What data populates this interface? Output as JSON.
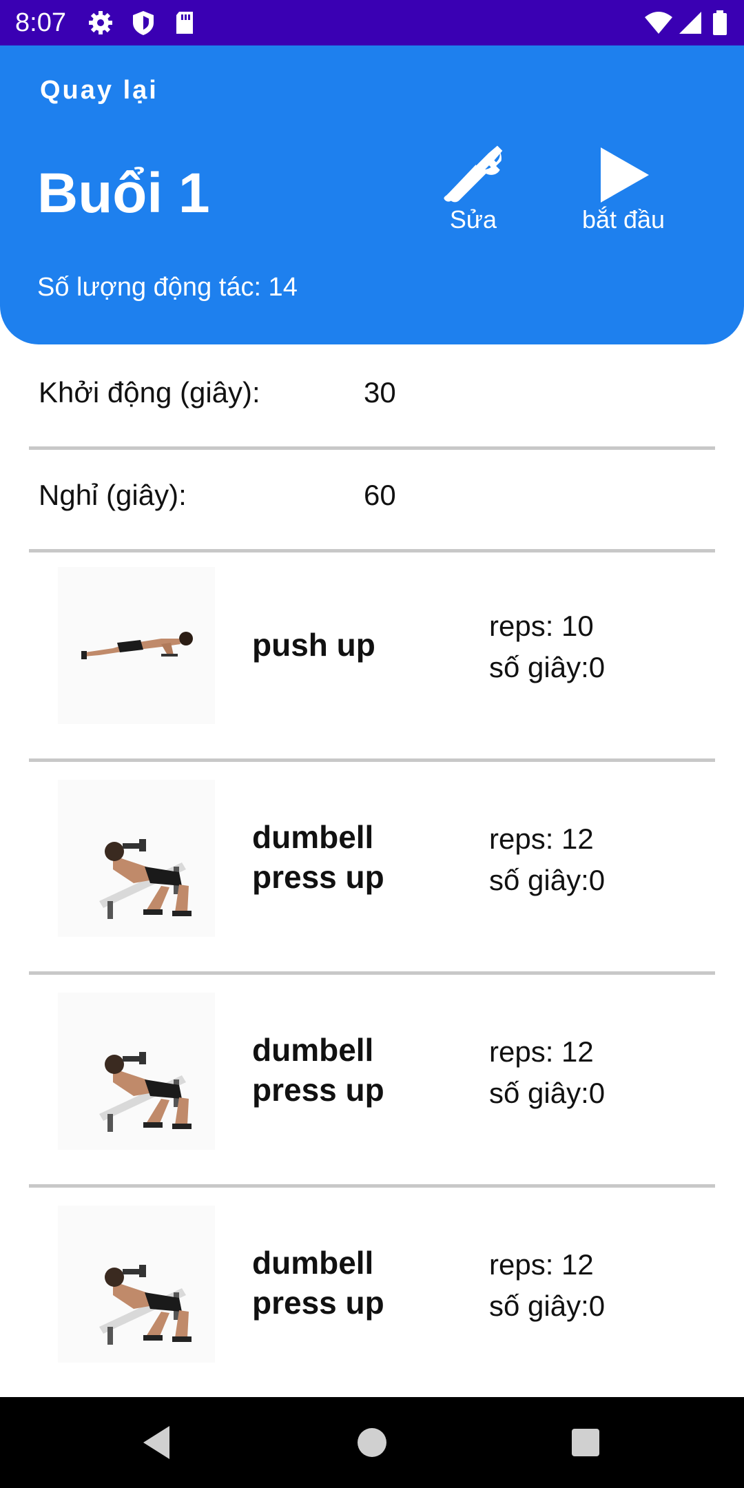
{
  "status_bar": {
    "time": "8:07",
    "left_icons": [
      "gear-icon",
      "shield-icon",
      "sd-card-icon"
    ],
    "right_icons": [
      "wifi-icon",
      "signal-icon",
      "battery-icon"
    ]
  },
  "header": {
    "back_label": "Quay lại",
    "title": "Buổi 1",
    "edit_label": "Sửa",
    "start_label": "bắt đầu",
    "exercise_count": "Số lượng động tác: 14",
    "background_color": "#1e80ee"
  },
  "settings": [
    {
      "label": "Khởi động (giây):",
      "value": "30"
    },
    {
      "label": "Nghỉ (giây):",
      "value": "60"
    }
  ],
  "exercises": [
    {
      "name": "push up",
      "reps": "reps: 10",
      "seconds": "số giây:0",
      "image": "push-up-image"
    },
    {
      "name": "dumbell press up",
      "reps": "reps: 12",
      "seconds": "số giây:0",
      "image": "dumbbell-press-image"
    },
    {
      "name": "dumbell press up",
      "reps": "reps: 12",
      "seconds": "số giây:0",
      "image": "dumbbell-press-image"
    },
    {
      "name": "dumbell press up",
      "reps": "reps: 12",
      "seconds": "số giây:0",
      "image": "dumbbell-press-image"
    }
  ],
  "nav_bar": {
    "buttons": [
      "back-triangle-icon",
      "home-circle-icon",
      "recents-square-icon"
    ]
  },
  "colors": {
    "status_bar": "#3a00b3",
    "header": "#1e80ee",
    "divider": "#c8c8c8"
  }
}
